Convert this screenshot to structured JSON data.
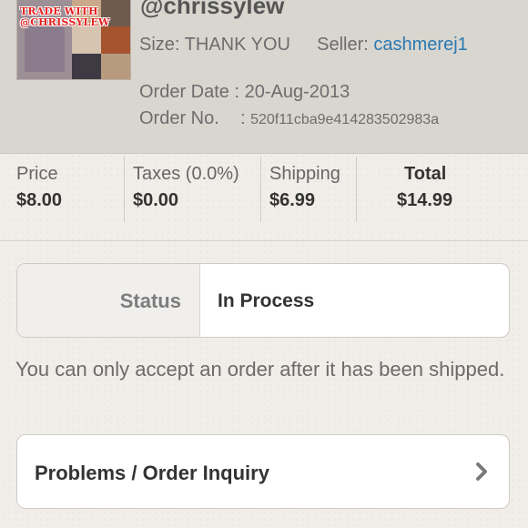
{
  "order": {
    "username": "@chrissylew",
    "size_label": "Size:",
    "size_value": "THANK YOU",
    "seller_label": "Seller:",
    "seller_value": "cashmerej1",
    "order_date_label": "Order Date :",
    "order_date_value": "20-Aug-2013",
    "order_no_label": "Order No.",
    "order_no_sep": ":",
    "order_no_value": "520f11cba9e414283502983a",
    "thumbnail_text": [
      "TRADE WITH",
      "@CHRISSYLEW"
    ]
  },
  "pricing": [
    {
      "label": "Price",
      "value": "$8.00"
    },
    {
      "label": "Taxes (0.0%)",
      "value": "$0.00"
    },
    {
      "label": "Shipping",
      "value": "$6.99"
    },
    {
      "label": "Total",
      "value": "$14.99"
    }
  ],
  "status": {
    "label": "Status",
    "value": "In Process"
  },
  "note": "You can only accept an order after it has been shipped.",
  "inquiry": {
    "label": "Problems / Order Inquiry",
    "icon": "chevron-right-icon"
  },
  "colors": {
    "link": "#2b79b0",
    "header_bg": "#d9d6d0",
    "thumbnail_text": "#e62020"
  }
}
